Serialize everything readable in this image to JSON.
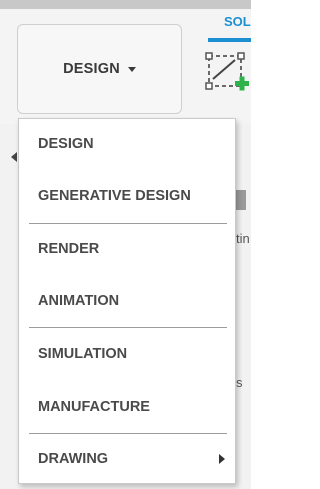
{
  "toolbar": {
    "workspace_label": "DESIGN",
    "tab_solid": "SOL"
  },
  "icons": {
    "workspace_caret": "caret-down-icon",
    "sketch": "create-sketch-icon",
    "submenu": "caret-right-icon",
    "back": "caret-left-icon"
  },
  "background": {
    "partial_a": "tin",
    "partial_b": "s"
  },
  "menu": {
    "items": [
      {
        "label": "DESIGN"
      },
      {
        "label": "GENERATIVE DESIGN"
      },
      {
        "label": "RENDER"
      },
      {
        "label": "ANIMATION"
      },
      {
        "label": "SIMULATION"
      },
      {
        "label": "MANUFACTURE"
      },
      {
        "label": "DRAWING",
        "has_submenu": true
      }
    ]
  },
  "colors": {
    "accent": "#1b8fd2",
    "add_green": "#2db34a",
    "menu_text": "#4a4a4a"
  }
}
